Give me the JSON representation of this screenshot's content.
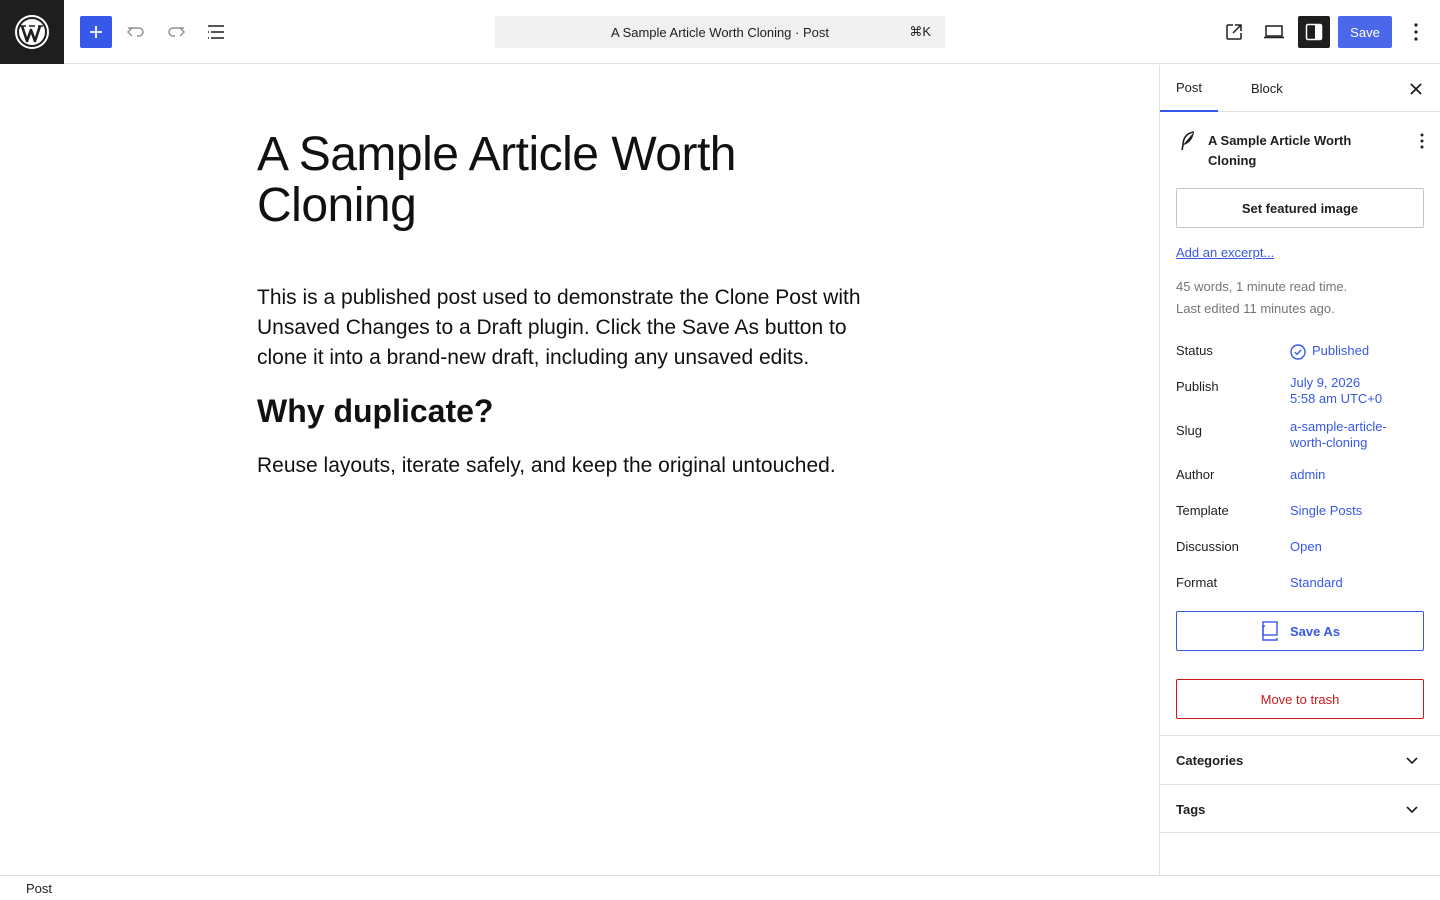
{
  "toolbar": {
    "document_title": "A Sample Article Worth Cloning · Post",
    "shortcut": "⌘K",
    "save_label": "Save"
  },
  "post": {
    "title": "A Sample Article Worth Cloning",
    "paragraph1": "This is a published post used to demonstrate the Clone Post with Unsaved Changes to a Draft plugin. Click the Save As button to clone it into a brand-new draft, including any unsaved edits.",
    "heading": "Why duplicate?",
    "paragraph2": "Reuse layouts, iterate safely, and keep the original untouched."
  },
  "sidebar": {
    "tabs": [
      {
        "label": "Post"
      },
      {
        "label": "Block"
      }
    ],
    "summary_title": "A Sample Article Worth Cloning",
    "featured_image_label": "Set featured image",
    "excerpt_link": "Add an excerpt...",
    "word_count": "45 words, 1 minute read time.",
    "last_edited": "Last edited 11 minutes ago.",
    "rows": {
      "status": {
        "label": "Status",
        "value": "Published"
      },
      "publish": {
        "label": "Publish",
        "value_line1": "July 9, 2026",
        "value_line2": "5:58 am UTC+0"
      },
      "slug": {
        "label": "Slug",
        "value_line1": "a-sample-article-",
        "value_line2": "worth-cloning"
      },
      "author": {
        "label": "Author",
        "value": "admin"
      },
      "template": {
        "label": "Template",
        "value": "Single Posts"
      },
      "discussion": {
        "label": "Discussion",
        "value": "Open"
      },
      "format": {
        "label": "Format",
        "value": "Standard"
      }
    },
    "save_as_label": "Save As",
    "trash_label": "Move to trash",
    "panels": [
      {
        "label": "Categories"
      },
      {
        "label": "Tags"
      }
    ]
  },
  "footer": {
    "breadcrumb": "Post"
  },
  "colors": {
    "accent": "#3858e9",
    "danger": "#cc1818",
    "dark": "#1e1e1e"
  }
}
